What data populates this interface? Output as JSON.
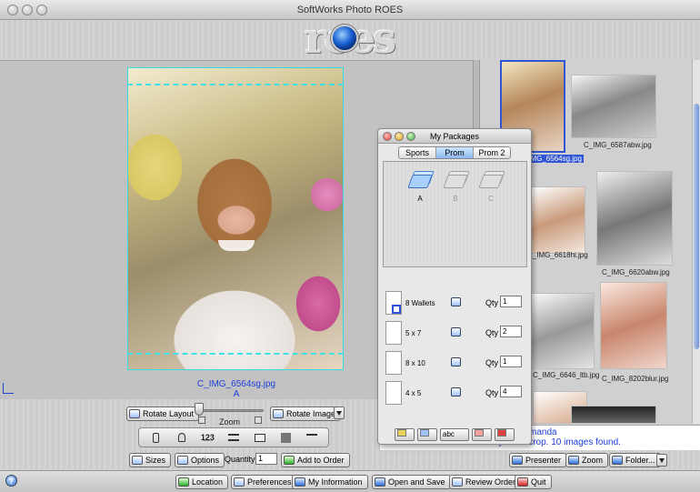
{
  "window": {
    "title": "SoftWorks Photo ROES"
  },
  "preview": {
    "filename": "C_IMG_6564sg.jpg",
    "package_letter": "A",
    "zoom_label": "Zoom"
  },
  "controls": {
    "rotate_layout": "Rotate Layout",
    "rotate_image": "Rotate Image",
    "sizes": "Sizes",
    "options": "Options",
    "quantity_label": "Quantity",
    "quantity_value": "1",
    "add_to_order": "Add to Order",
    "tool_123": "1̲2̲3"
  },
  "browser": {
    "thumbnails": [
      {
        "label": "C_IMG_6564sg.jpg",
        "selected": true
      },
      {
        "label": "C_IMG_6587abw.jpg"
      },
      {
        "label": "C_IMG_6618hi.jpg"
      },
      {
        "label": "C_IMG_6620abw.jpg"
      },
      {
        "label": "C_IMG_6646_ltb.jpg"
      },
      {
        "label": "C_IMG_8202blur.jpg"
      }
    ],
    "presenter": "Presenter",
    "zoom": "Zoom",
    "folder": "Folder..."
  },
  "status": {
    "line1": "Amanda",
    "line2": "s to the layout to crop. 10 images found."
  },
  "toolbar": {
    "location": "Location",
    "preferences": "Preferences",
    "my_information": "My Information",
    "open_and_save": "Open and Save",
    "review_order": "Review Order",
    "quit": "Quit"
  },
  "packages_panel": {
    "title": "My Packages",
    "tabs": [
      {
        "label": "Sports"
      },
      {
        "label": "Prom",
        "selected": true
      },
      {
        "label": "Prom 2"
      }
    ],
    "packages": [
      {
        "label": "A"
      },
      {
        "label": "B"
      },
      {
        "label": "C"
      }
    ],
    "rows": [
      {
        "name": "8 Wallets",
        "qty_label": "Qty",
        "qty": "1"
      },
      {
        "name": "5 x 7",
        "qty_label": "Qty",
        "qty": "2"
      },
      {
        "name": "8 x 10",
        "qty_label": "Qty",
        "qty": "1"
      },
      {
        "name": "4 x 5",
        "qty_label": "Qty",
        "qty": "4"
      }
    ],
    "bottom_button_abc": "abc"
  },
  "colors": {
    "crop_guide": "#3fe0e6",
    "link_blue": "#1f3fd8",
    "selection_blue": "#2f55d4"
  }
}
